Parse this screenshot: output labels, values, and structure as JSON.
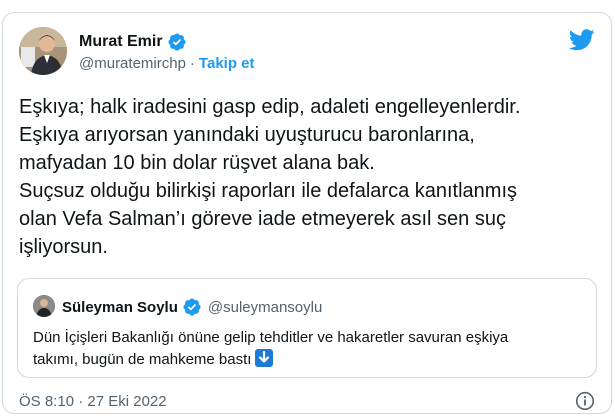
{
  "author": {
    "name": "Murat Emir",
    "handle": "@muratemirchp",
    "separator": "·",
    "follow_label": "Takip et"
  },
  "tweet_lines": [
    "Eşkıya; halk iradesini gasp edip, adaleti engelleyenlerdir.",
    "Eşkıya arıyorsan yanındaki uyuşturucu baronlarına,",
    "mafyadan 10 bin dolar rüşvet alana bak.",
    "Suçsuz olduğu bilirkişi raporları ile defalarca kanıtlanmış",
    "olan Vefa Salman’ı göreve iade etmeyerek asıl sen suç",
    "işliyorsun."
  ],
  "quote": {
    "name": "Süleyman Soylu",
    "handle": "@suleymansoylu",
    "lines": [
      "Dün İçişleri Bakanlığı önüne gelip tehditler ve hakaretler savuran eşkiya",
      "takımı, bugün de mahkeme bastı"
    ],
    "emoji": "down-arrow-emoji"
  },
  "footer": {
    "timestamp": "ÖS 8:10 · 27 Eki 2022"
  },
  "colors": {
    "accent": "#1d9bf0",
    "text": "#0f1419",
    "secondary": "#536471",
    "border": "#cfd9de"
  },
  "icons": {
    "verified": "verified-badge-icon",
    "logo": "twitter-bird-icon",
    "info": "info-icon"
  }
}
